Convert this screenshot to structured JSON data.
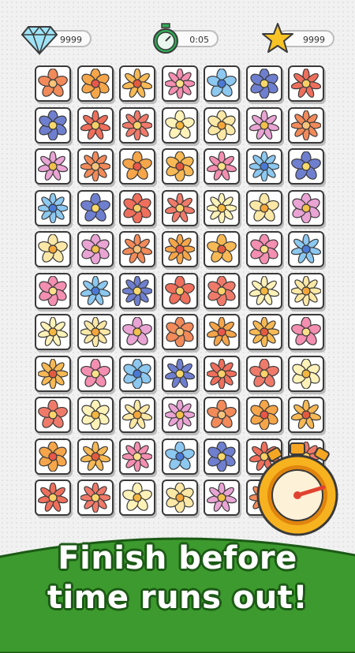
{
  "hud": {
    "gems": "9999",
    "timer": "0:05",
    "stars": "9999",
    "gem_icon": "diamond-icon",
    "timer_icon": "stopwatch-icon",
    "star_icon": "star-icon"
  },
  "caption": {
    "line1": "Finish before",
    "line2": "time runs out!"
  },
  "colors": {
    "banner_green": "#3d9a2e",
    "banner_dark": "#1c5a16",
    "tile_border": "#3a3a3a",
    "timer_orange": "#f5a623"
  },
  "board": {
    "rows": 11,
    "cols": 7,
    "tile_icon": "flower-icon"
  }
}
